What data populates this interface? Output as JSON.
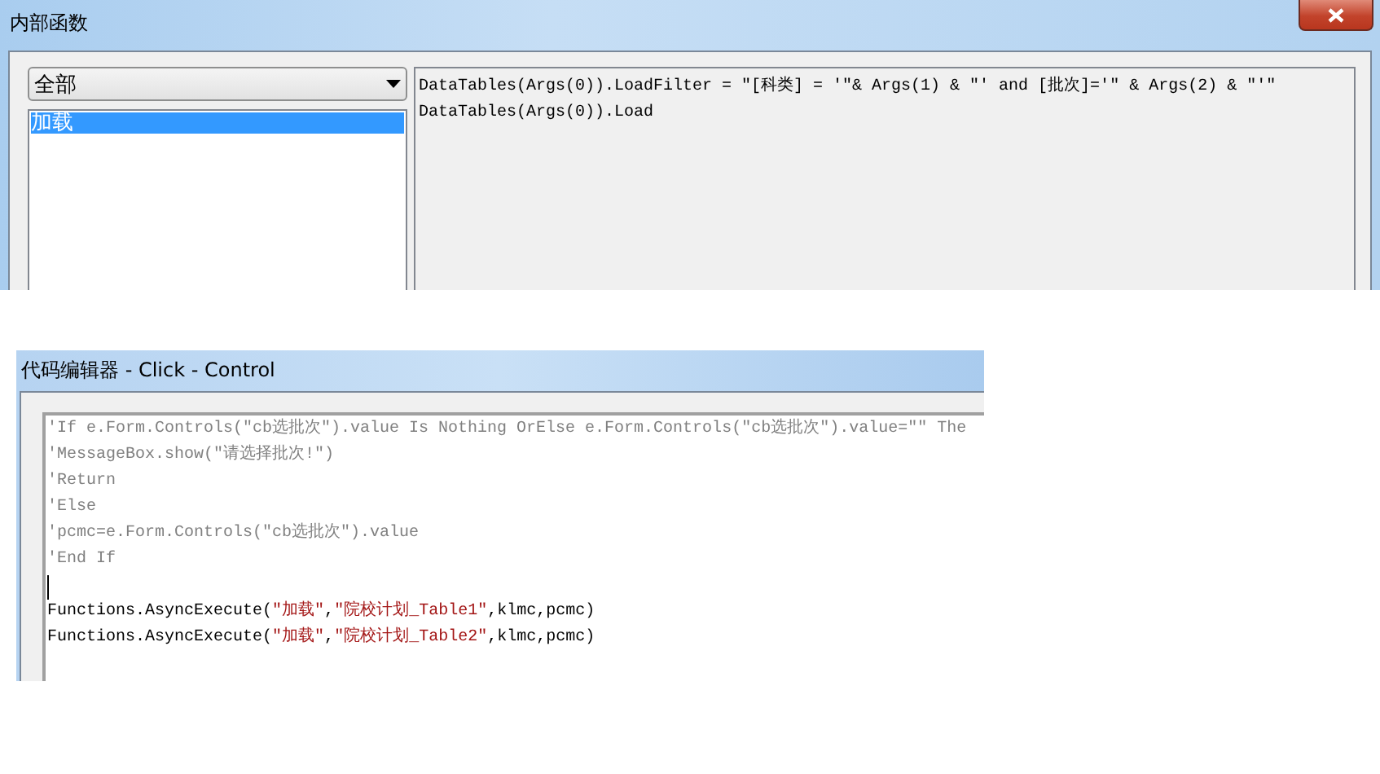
{
  "internal_functions_window": {
    "title": "内部函数",
    "filter_dropdown": {
      "value": "全部"
    },
    "function_list": [
      {
        "label": "加载",
        "selected": true
      }
    ],
    "code_lines": [
      "DataTables(Args(0)).LoadFilter = \"[科类] = '\"& Args(1) & \"' and [批次]='\" & Args(2) & \"'\"",
      "DataTables(Args(0)).Load"
    ]
  },
  "code_editor_window": {
    "title": "代码编辑器 - Click - Control",
    "lines": [
      {
        "caret": false,
        "segments": [
          {
            "kind": "comment",
            "text": "'If e.Form.Controls(\"cb选批次\").value Is Nothing OrElse e.Form.Controls(\"cb选批次\").value=\"\" The"
          }
        ]
      },
      {
        "caret": false,
        "segments": [
          {
            "kind": "comment",
            "text": "'MessageBox.show(\"请选择批次!\")"
          }
        ]
      },
      {
        "caret": false,
        "segments": [
          {
            "kind": "comment",
            "text": "'Return"
          }
        ]
      },
      {
        "caret": false,
        "segments": [
          {
            "kind": "comment",
            "text": "'Else"
          }
        ]
      },
      {
        "caret": false,
        "segments": [
          {
            "kind": "comment",
            "text": "'pcmc=e.Form.Controls(\"cb选批次\").value"
          }
        ]
      },
      {
        "caret": false,
        "segments": [
          {
            "kind": "comment",
            "text": "'End If"
          }
        ]
      },
      {
        "caret": true
      },
      {
        "caret": false,
        "segments": [
          {
            "kind": "code",
            "text": "Functions.AsyncExecute("
          },
          {
            "kind": "string",
            "text": "\"加载\""
          },
          {
            "kind": "code",
            "text": ","
          },
          {
            "kind": "string",
            "text": "\"院校计划_Table1\""
          },
          {
            "kind": "code",
            "text": ",klmc,pcmc)"
          }
        ]
      },
      {
        "caret": false,
        "segments": [
          {
            "kind": "code",
            "text": "Functions.AsyncExecute("
          },
          {
            "kind": "string",
            "text": "\"加载\""
          },
          {
            "kind": "code",
            "text": ","
          },
          {
            "kind": "string",
            "text": "\"院校计划_Table2\""
          },
          {
            "kind": "code",
            "text": ",klmc,pcmc)"
          }
        ]
      }
    ]
  }
}
